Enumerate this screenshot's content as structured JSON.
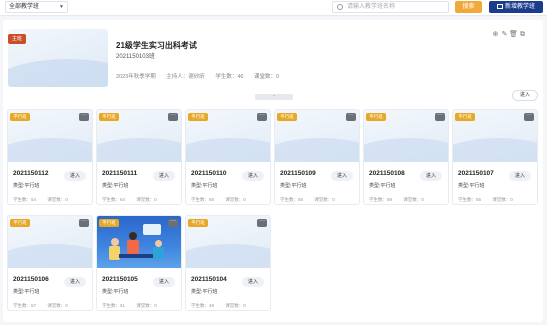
{
  "topbar": {
    "select_value": "全部教学班",
    "search_placeholder": "请输入教学班名称",
    "search_button": "搜索",
    "add_button": "新增教学班"
  },
  "hero": {
    "tag": "主班",
    "title": "21级学生实习出科考试",
    "code": "2021150103班",
    "term": "2023年秋季学期",
    "host": "主持人：谢欣昕",
    "students": "学生数：46",
    "lessons": "课堂数：0",
    "enter": "进入",
    "collapse": "⌃"
  },
  "cards": [
    {
      "tag": "平行班",
      "name": "2021150112",
      "type": "类型:平行班",
      "enter": "进入",
      "students": "学生数：54",
      "lessons": "课堂数：0",
      "photo": false
    },
    {
      "tag": "平行班",
      "name": "2021150111",
      "type": "类型:平行班",
      "enter": "进入",
      "students": "学生数：64",
      "lessons": "课堂数：0",
      "photo": false
    },
    {
      "tag": "平行班",
      "name": "2021150110",
      "type": "类型:平行班",
      "enter": "进入",
      "students": "学生数：60",
      "lessons": "课堂数：0",
      "photo": false
    },
    {
      "tag": "平行班",
      "name": "2021150109",
      "type": "类型:平行班",
      "enter": "进入",
      "students": "学生数：55",
      "lessons": "课堂数：0",
      "photo": false
    },
    {
      "tag": "平行班",
      "name": "2021150108",
      "type": "类型:平行班",
      "enter": "进入",
      "students": "学生数：59",
      "lessons": "课堂数：0",
      "photo": false
    },
    {
      "tag": "平行班",
      "name": "2021150107",
      "type": "类型:平行班",
      "enter": "进入",
      "students": "学生数：55",
      "lessons": "课堂数：0",
      "photo": false
    },
    {
      "tag": "平行班",
      "name": "2021150106",
      "type": "类型:平行班",
      "enter": "进入",
      "students": "学生数：57",
      "lessons": "课堂数：0",
      "photo": false
    },
    {
      "tag": "平行班",
      "name": "2021150105",
      "type": "类型:平行班",
      "enter": "进入",
      "students": "学生数：61",
      "lessons": "课堂数：0",
      "photo": true
    },
    {
      "tag": "平行班",
      "name": "2021150104",
      "type": "类型:平行班",
      "enter": "进入",
      "students": "学生数：49",
      "lessons": "课堂数：0",
      "photo": false
    }
  ],
  "colors": {
    "brand": "#1b3c8c",
    "search_btn": "#f2a93b",
    "main_tag": "#c84f2a",
    "parallel_tag": "#e7a826"
  },
  "icons": [
    "search-icon",
    "add-class-icon",
    "settings-icon",
    "edit-icon",
    "delete-icon",
    "copy-icon",
    "more-icon"
  ]
}
